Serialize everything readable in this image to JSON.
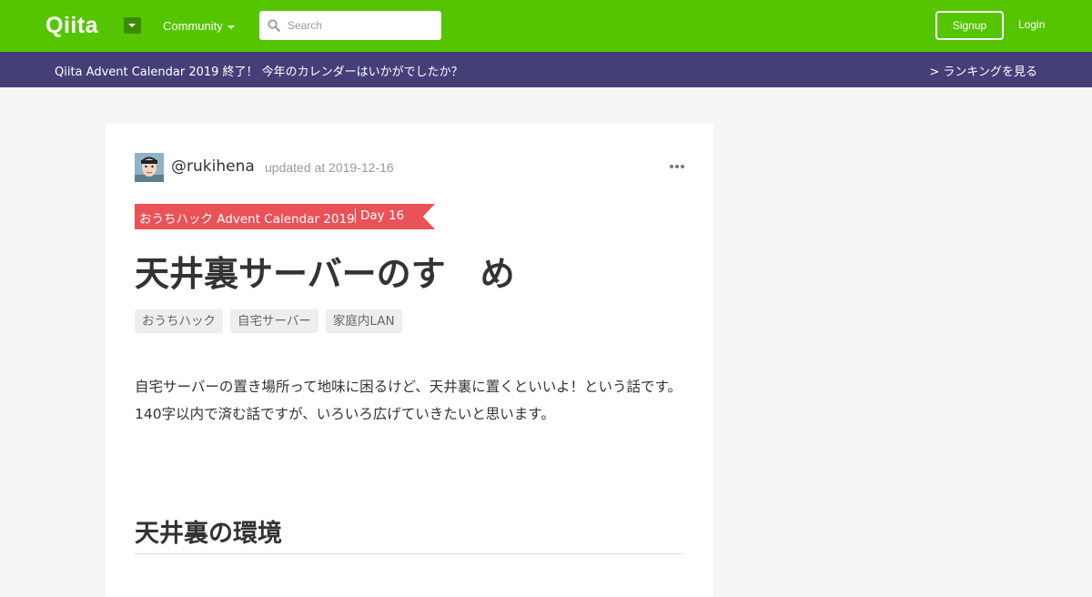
{
  "header": {
    "logo": "Qiita",
    "community_label": "Community",
    "search_placeholder": "Search",
    "signup_label": "Signup",
    "login_label": "Login"
  },
  "banner": {
    "text": "Qiita Advent Calendar 2019 終了！ 今年のカレンダーはいかがでしたか？",
    "link": "> ランキングを見る"
  },
  "article": {
    "author": "@rukihena",
    "updated": "updated at 2019-12-16",
    "calendar": "おうちハック Advent Calendar 2019",
    "day": "Day 16",
    "title": "天井裏サーバーのす　め",
    "tags": [
      "おうちハック",
      "自宅サーバー",
      "家庭内LAN"
    ],
    "paragraph_1": "自宅サーバーの置き場所って地味に困るけど、天井裏に置くといいよ！という話です。",
    "paragraph_2": "140字以内で済む話ですが、いろいろ広げていきたいと思います。",
    "section_heading": "天井裏の環境"
  },
  "colors": {
    "brand_green": "#55c500",
    "banner_purple": "#453f78",
    "ribbon_red": "#ea5258"
  }
}
